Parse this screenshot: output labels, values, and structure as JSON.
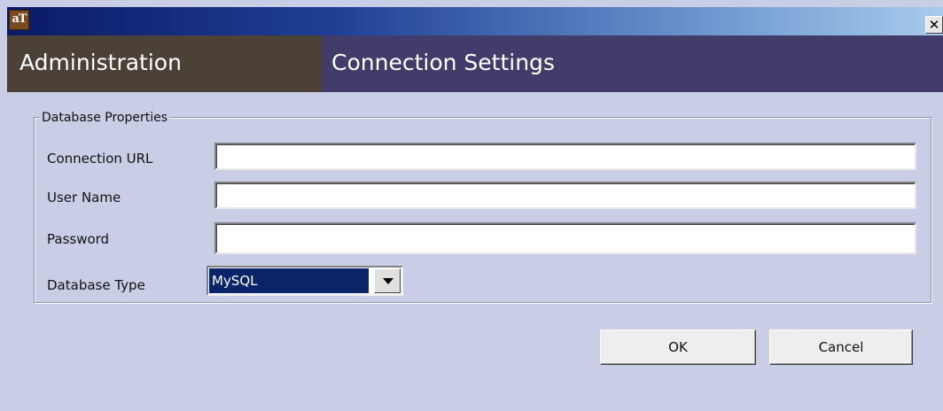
{
  "window": {
    "logo_text": "aT",
    "close_symbol": "✕",
    "app_logo_icon": "app-logo-icon",
    "close_icon": "close-icon"
  },
  "header": {
    "left_title": "Administration",
    "right_title": "Connection Settings",
    "left_color": "#4b4137",
    "right_color": "#423c6a"
  },
  "group": {
    "legend": "Database Properties",
    "fields": {
      "connection_url": {
        "label": "Connection URL",
        "value": ""
      },
      "user_name": {
        "label": "User Name",
        "value": ""
      },
      "password": {
        "label": "Password",
        "value": ""
      },
      "database_type": {
        "label": "Database Type",
        "value": "MySQL",
        "dropdown_icon": "chevron-down-icon"
      }
    }
  },
  "buttons": {
    "ok": "OK",
    "cancel": "Cancel"
  }
}
